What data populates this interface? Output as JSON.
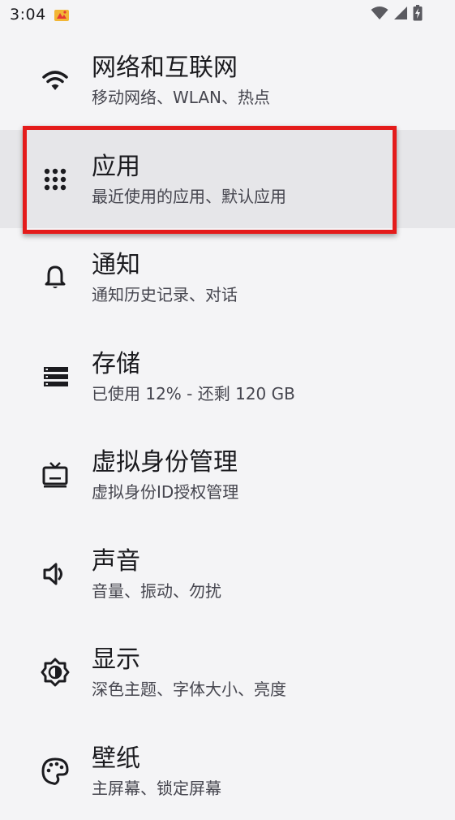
{
  "status_bar": {
    "time": "3:04",
    "notification_icon": "game-controller-icon",
    "icons": [
      "wifi-icon",
      "cellular-signal-icon",
      "battery-charging-icon"
    ]
  },
  "settings": {
    "items": [
      {
        "title": "网络和互联网",
        "subtitle": "移动网络、WLAN、热点",
        "icon": "wifi-icon"
      },
      {
        "title": "应用",
        "subtitle": "最近使用的应用、默认应用",
        "icon": "apps-grid-icon"
      },
      {
        "title": "通知",
        "subtitle": "通知历史记录、对话",
        "icon": "bell-icon"
      },
      {
        "title": "存储",
        "subtitle": "已使用 12% - 还剩 120 GB",
        "icon": "storage-icon"
      },
      {
        "title": "虚拟身份管理",
        "subtitle": "虚拟身份ID授权管理",
        "icon": "tv-icon"
      },
      {
        "title": "声音",
        "subtitle": "音量、振动、勿扰",
        "icon": "volume-icon"
      },
      {
        "title": "显示",
        "subtitle": "深色主题、字体大小、亮度",
        "icon": "brightness-icon"
      },
      {
        "title": "壁纸",
        "subtitle": "主屏幕、锁定屏幕",
        "icon": "palette-icon"
      }
    ]
  },
  "colors": {
    "background": "#f4f4f6",
    "highlight_row": "#e6e6e9",
    "highlight_border": "#e41b1b",
    "icon": "#1b1b1f"
  }
}
